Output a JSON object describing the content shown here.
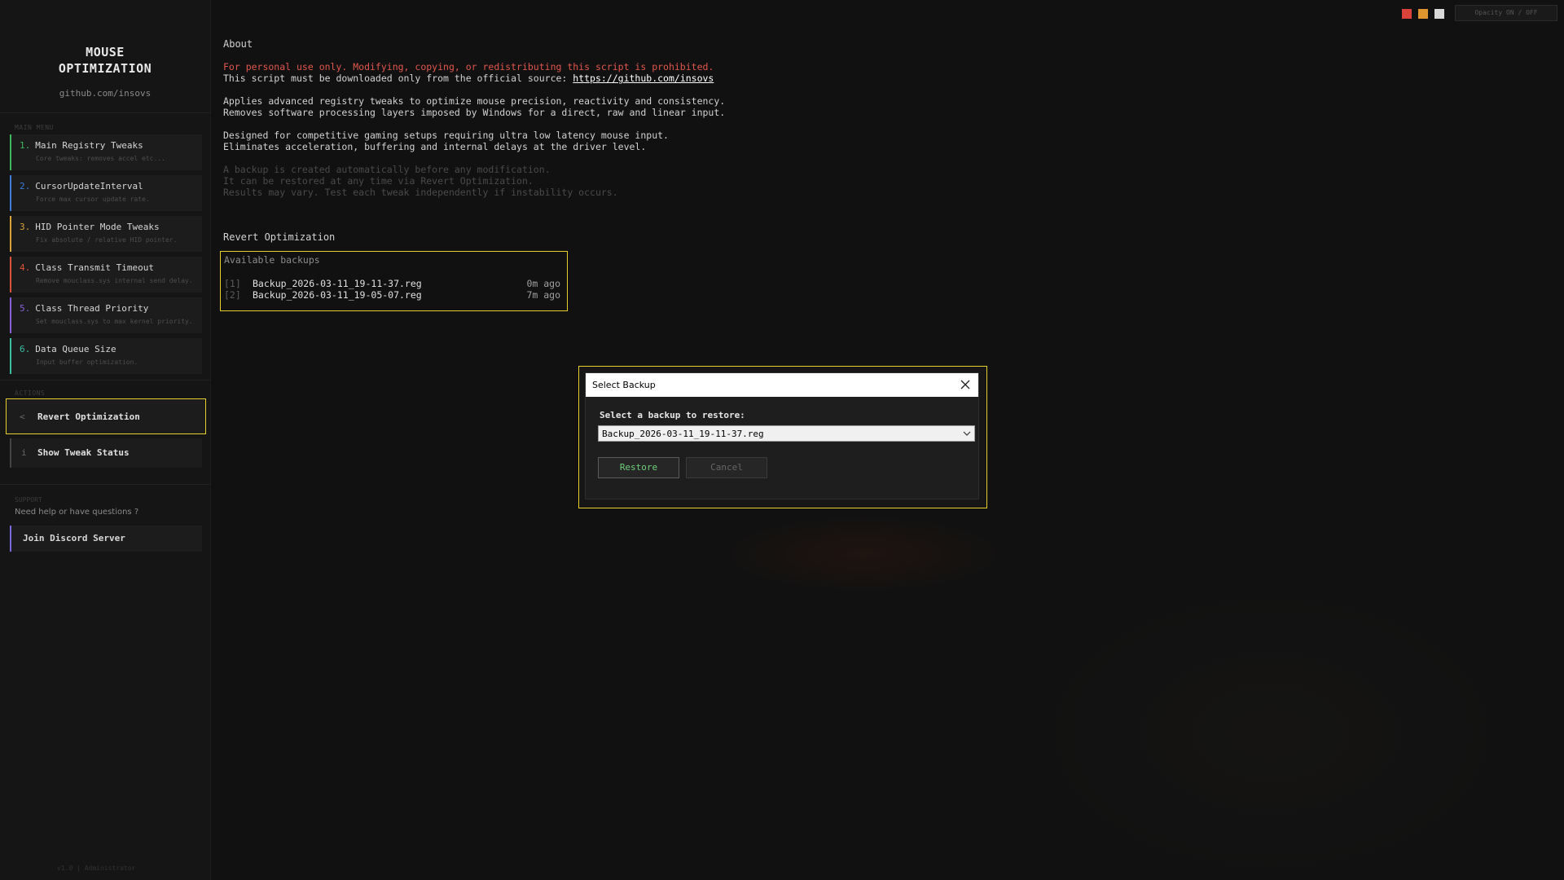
{
  "sidebar": {
    "brand_line1": "MOUSE",
    "brand_line2": "OPTIMIZATION",
    "brand_sub": "github.com/insovs",
    "main_menu_label": "MAIN MENU",
    "menu": [
      {
        "num": "1.",
        "title": "Main Registry Tweaks",
        "desc": "Core tweaks: removes accel etc...",
        "color": "#3fb85f"
      },
      {
        "num": "2.",
        "title": "CursorUpdateInterval",
        "desc": "Force max cursor update rate.",
        "color": "#3b7dd8"
      },
      {
        "num": "3.",
        "title": "HID Pointer Mode Tweaks",
        "desc": "Fix absolute / relative HID pointer.",
        "color": "#d9a33a"
      },
      {
        "num": "4.",
        "title": "Class Transmit Timeout",
        "desc": "Remove mouclass.sys internal send delay.",
        "color": "#d9533a"
      },
      {
        "num": "5.",
        "title": "Class Thread Priority",
        "desc": "Set mouclass.sys to max kernel priority.",
        "color": "#8a5fd8"
      },
      {
        "num": "6.",
        "title": "Data Queue Size",
        "desc": "Input buffer optimization.",
        "color": "#3bbfa3"
      }
    ],
    "actions_label": "ACTIONS",
    "actions": [
      {
        "icon": "<",
        "label": "Revert Optimization"
      },
      {
        "icon": "i",
        "label": "Show Tweak Status"
      }
    ],
    "support_label": "SUPPORT",
    "support_text": "Need help or have questions ?",
    "discord_label": "Join Discord Server",
    "footer": "v1.0  |  Administrator"
  },
  "topbar": {
    "opacity_label": "Opacity  ON / OFF",
    "swatches": [
      "#d9433a",
      "#e0952e",
      "#d8d8d8"
    ]
  },
  "about": {
    "heading": "About",
    "warn1": "For personal use only. Modifying, copying, or redistributing this script is prohibited.",
    "warn2_prefix": "This script must be downloaded only from the official source: ",
    "warn2_link": "https://github.com/insovs",
    "p1": "Applies advanced registry tweaks to optimize mouse precision, reactivity and consistency.",
    "p2": "Removes software processing layers imposed by Windows for a direct, raw and linear input.",
    "p3": "Designed for competitive gaming setups requiring ultra low latency mouse input.",
    "p4": "Eliminates acceleration, buffering and internal delays at the driver level.",
    "n1": "A backup is created automatically before any modification.",
    "n2": "It can be restored at any time via Revert Optimization.",
    "n3": "Results may vary. Test each tweak independently if instability occurs."
  },
  "revert": {
    "heading": "Revert Optimization",
    "box_title": "Available backups",
    "backups": [
      {
        "idx": "[1]",
        "name": "Backup_2026-03-11_19-11-37.reg",
        "age": "0m ago"
      },
      {
        "idx": "[2]",
        "name": "Backup_2026-03-11_19-05-07.reg",
        "age": "7m ago"
      }
    ]
  },
  "dialog": {
    "title": "Select Backup",
    "prompt": "Select a backup to restore:",
    "selected": "Backup_2026-03-11_19-11-37.reg",
    "restore_label": "Restore",
    "cancel_label": "Cancel"
  }
}
